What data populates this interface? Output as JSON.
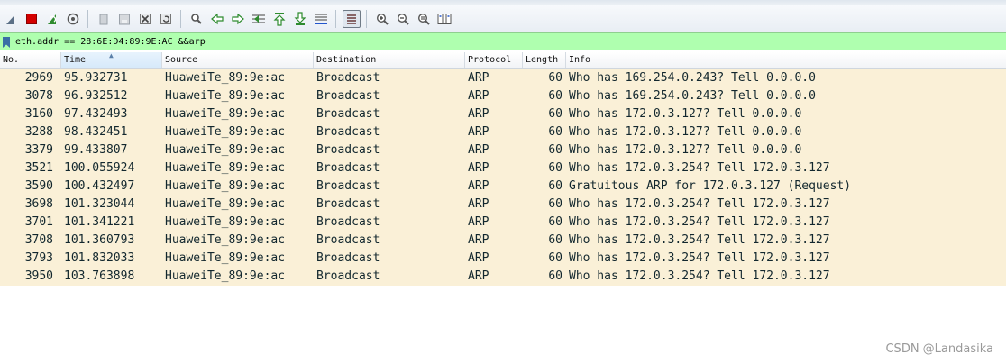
{
  "toolbar": {
    "buttons": [
      {
        "icon": "shark-fin-icon"
      },
      {
        "icon": "stop-capture-icon",
        "color": "#d40000"
      },
      {
        "icon": "restart-capture-icon",
        "color": "#2e8b2e"
      },
      {
        "icon": "capture-options-icon"
      },
      {
        "icon": "open-file-icon"
      },
      {
        "icon": "save-file-icon"
      },
      {
        "icon": "close-file-icon"
      },
      {
        "icon": "reload-file-icon"
      },
      {
        "icon": "find-packet-icon"
      },
      {
        "icon": "go-back-icon",
        "color": "#2e8b2e"
      },
      {
        "icon": "go-forward-icon",
        "color": "#2e8b2e"
      },
      {
        "icon": "go-to-packet-icon",
        "color": "#2e8b2e"
      },
      {
        "icon": "first-packet-icon",
        "color": "#2e8b2e"
      },
      {
        "icon": "last-packet-icon",
        "color": "#2e8b2e"
      },
      {
        "icon": "auto-scroll-icon"
      },
      {
        "icon": "colorize-icon"
      },
      {
        "icon": "zoom-in-icon"
      },
      {
        "icon": "zoom-out-icon"
      },
      {
        "icon": "normal-size-icon"
      },
      {
        "icon": "resize-columns-icon"
      }
    ]
  },
  "filter": {
    "text": "eth.addr == 28:6E:D4:89:9E:AC &&arp",
    "background": "#afffaf"
  },
  "columns": {
    "no": "No.",
    "time": "Time",
    "source": "Source",
    "destination": "Destination",
    "protocol": "Protocol",
    "length": "Length",
    "info": "Info"
  },
  "rows": [
    {
      "no": "2969",
      "time": "95.932731",
      "source": "HuaweiTe_89:9e:ac",
      "destination": "Broadcast",
      "protocol": "ARP",
      "length": "60",
      "info": "Who has 169.254.0.243? Tell 0.0.0.0"
    },
    {
      "no": "3078",
      "time": "96.932512",
      "source": "HuaweiTe_89:9e:ac",
      "destination": "Broadcast",
      "protocol": "ARP",
      "length": "60",
      "info": "Who has 169.254.0.243? Tell 0.0.0.0"
    },
    {
      "no": "3160",
      "time": "97.432493",
      "source": "HuaweiTe_89:9e:ac",
      "destination": "Broadcast",
      "protocol": "ARP",
      "length": "60",
      "info": "Who has 172.0.3.127? Tell 0.0.0.0"
    },
    {
      "no": "3288",
      "time": "98.432451",
      "source": "HuaweiTe_89:9e:ac",
      "destination": "Broadcast",
      "protocol": "ARP",
      "length": "60",
      "info": "Who has 172.0.3.127? Tell 0.0.0.0"
    },
    {
      "no": "3379",
      "time": "99.433807",
      "source": "HuaweiTe_89:9e:ac",
      "destination": "Broadcast",
      "protocol": "ARP",
      "length": "60",
      "info": "Who has 172.0.3.127? Tell 0.0.0.0"
    },
    {
      "no": "3521",
      "time": "100.055924",
      "source": "HuaweiTe_89:9e:ac",
      "destination": "Broadcast",
      "protocol": "ARP",
      "length": "60",
      "info": "Who has 172.0.3.254? Tell 172.0.3.127"
    },
    {
      "no": "3590",
      "time": "100.432497",
      "source": "HuaweiTe_89:9e:ac",
      "destination": "Broadcast",
      "protocol": "ARP",
      "length": "60",
      "info": "Gratuitous ARP for 172.0.3.127 (Request)"
    },
    {
      "no": "3698",
      "time": "101.323044",
      "source": "HuaweiTe_89:9e:ac",
      "destination": "Broadcast",
      "protocol": "ARP",
      "length": "60",
      "info": "Who has 172.0.3.254? Tell 172.0.3.127"
    },
    {
      "no": "3701",
      "time": "101.341221",
      "source": "HuaweiTe_89:9e:ac",
      "destination": "Broadcast",
      "protocol": "ARP",
      "length": "60",
      "info": "Who has 172.0.3.254? Tell 172.0.3.127"
    },
    {
      "no": "3708",
      "time": "101.360793",
      "source": "HuaweiTe_89:9e:ac",
      "destination": "Broadcast",
      "protocol": "ARP",
      "length": "60",
      "info": "Who has 172.0.3.254? Tell 172.0.3.127"
    },
    {
      "no": "3793",
      "time": "101.832033",
      "source": "HuaweiTe_89:9e:ac",
      "destination": "Broadcast",
      "protocol": "ARP",
      "length": "60",
      "info": "Who has 172.0.3.254? Tell 172.0.3.127"
    },
    {
      "no": "3950",
      "time": "103.763898",
      "source": "HuaweiTe_89:9e:ac",
      "destination": "Broadcast",
      "protocol": "ARP",
      "length": "60",
      "info": "Who has 172.0.3.254? Tell 172.0.3.127"
    }
  ],
  "row_color": "#faf0d7",
  "watermark": "CSDN @Landasika"
}
